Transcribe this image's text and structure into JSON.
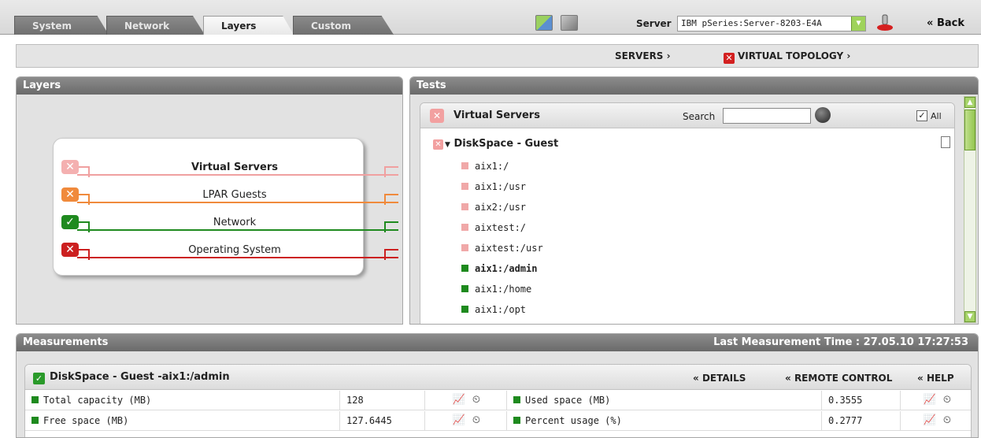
{
  "tabs": [
    {
      "label": "System",
      "active": false
    },
    {
      "label": "Network",
      "active": false
    },
    {
      "label": "Layers",
      "active": true
    },
    {
      "label": "Custom",
      "active": false
    }
  ],
  "server": {
    "label": "Server",
    "value": "IBM pSeries:Server-8203-E4A"
  },
  "back_label": "Back",
  "breadcrumb": {
    "servers": "SERVERS",
    "virtual_topology": "VIRTUAL TOPOLOGY"
  },
  "layers_panel": {
    "title": "Layers",
    "items": [
      {
        "label": "Virtual Servers",
        "status": "error-light",
        "color": "#f0a0a0"
      },
      {
        "label": "LPAR Guests",
        "status": "warning",
        "color": "#f08a3c"
      },
      {
        "label": "Network",
        "status": "ok",
        "color": "#1f8a1f"
      },
      {
        "label": "Operating System",
        "status": "error",
        "color": "#cc2020"
      }
    ]
  },
  "tests_panel": {
    "title": "Tests",
    "virtual_servers": "Virtual Servers",
    "search_label": "Search",
    "search_value": "",
    "all_label": "All",
    "group": "DiskSpace - Guest",
    "items": [
      {
        "label": "aix1:/",
        "status": "pink"
      },
      {
        "label": "aix1:/usr",
        "status": "pink"
      },
      {
        "label": "aix2:/usr",
        "status": "pink"
      },
      {
        "label": "aixtest:/",
        "status": "pink"
      },
      {
        "label": "aixtest:/usr",
        "status": "pink"
      },
      {
        "label": "aix1:/admin",
        "status": "green",
        "selected": true
      },
      {
        "label": "aix1:/home",
        "status": "green"
      },
      {
        "label": "aix1:/opt",
        "status": "green"
      }
    ]
  },
  "measurements": {
    "title": "Measurements",
    "last_time": "Last Measurement Time : 27.05.10 17:27:53",
    "test_title": "DiskSpace - Guest -aix1:/admin",
    "links": {
      "details": "DETAILS",
      "remote": "REMOTE CONTROL",
      "help": "HELP"
    },
    "rows": [
      {
        "left_name": "Total capacity (MB)",
        "left_value": "128",
        "right_name": "Used space (MB)",
        "right_value": "0.3555"
      },
      {
        "left_name": "Free space (MB)",
        "left_value": "127.6445",
        "right_name": "Percent usage (%)",
        "right_value": "0.2777"
      }
    ]
  },
  "colors": {
    "pink": "#f0a8a8",
    "green": "#1e8a1e"
  }
}
